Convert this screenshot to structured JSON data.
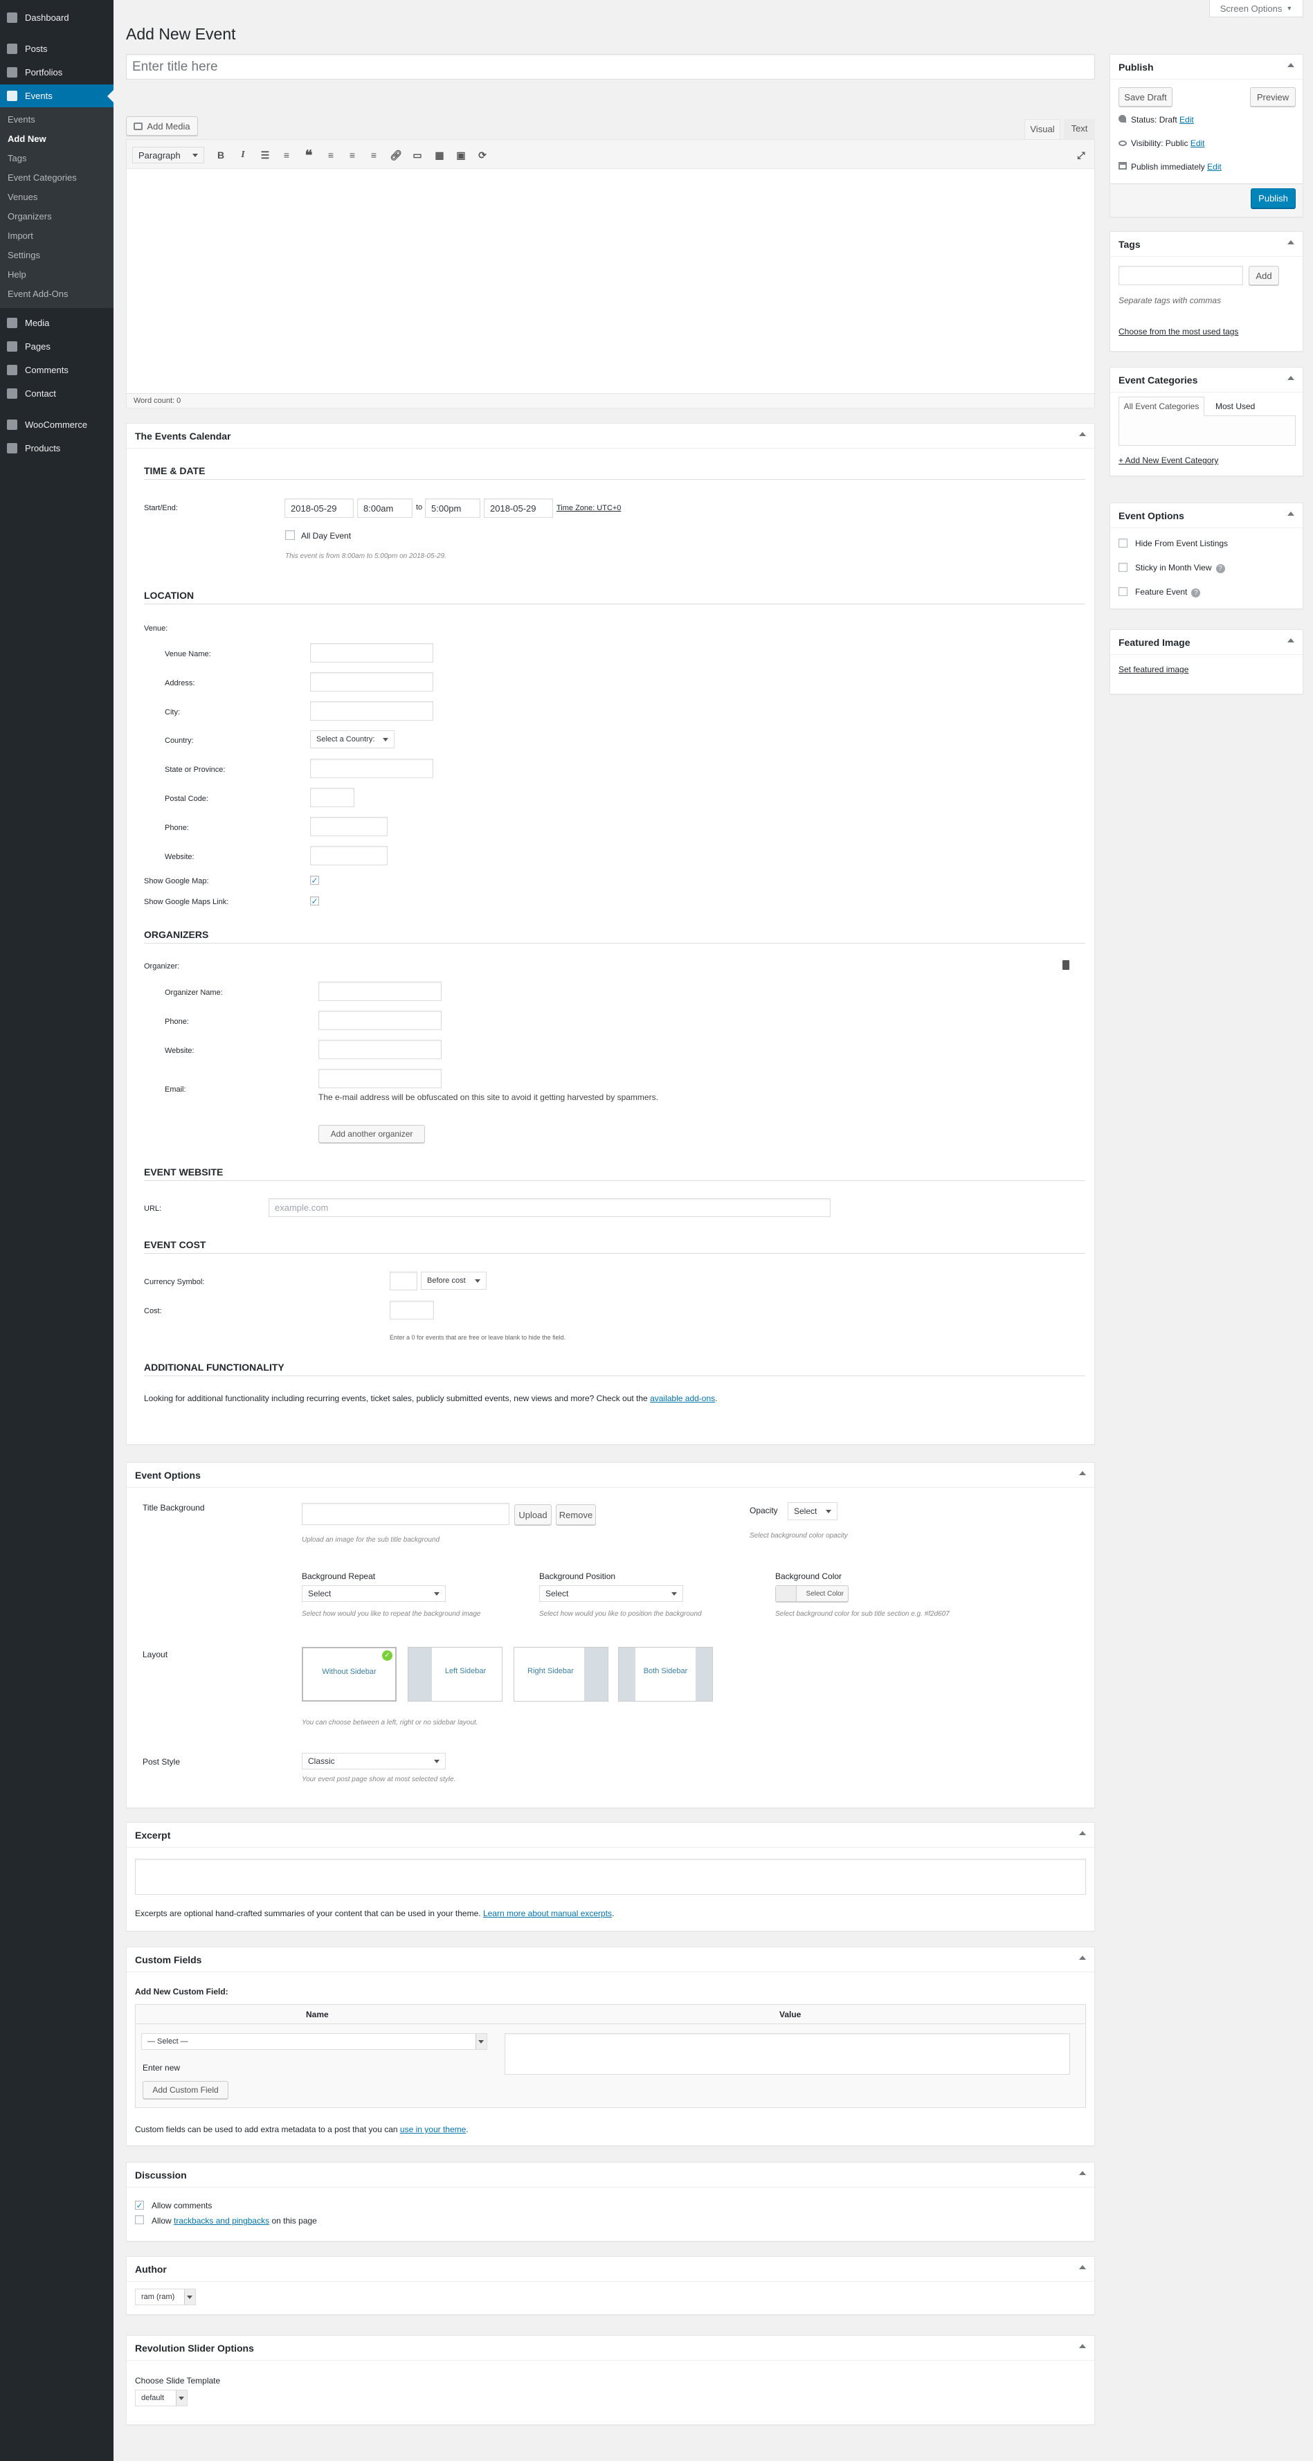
{
  "menu": {
    "items": [
      {
        "label": "Dashboard",
        "icon": "dashboard-icon",
        "name": "menu-dashboard"
      },
      {
        "label": "Posts",
        "icon": "pushpin-icon",
        "name": "menu-posts"
      },
      {
        "label": "Portfolios",
        "icon": "portfolio-icon",
        "name": "menu-portfolios"
      },
      {
        "label": "Events",
        "icon": "calendar-icon",
        "name": "menu-events"
      },
      {
        "label": "Media",
        "icon": "media-icon",
        "name": "menu-media"
      },
      {
        "label": "Pages",
        "icon": "page-icon",
        "name": "menu-pages"
      },
      {
        "label": "Comments",
        "icon": "comment-icon",
        "name": "menu-comments"
      },
      {
        "label": "Contact",
        "icon": "envelope-icon",
        "name": "menu-contact"
      },
      {
        "label": "WooCommerce",
        "icon": "woocommerce-icon",
        "name": "menu-woocommerce"
      },
      {
        "label": "Products",
        "icon": "products-icon",
        "name": "menu-products"
      }
    ],
    "submenu": [
      "Events",
      "Add New",
      "Tags",
      "Event Categories",
      "Venues",
      "Organizers",
      "Import",
      "Settings",
      "Help",
      "Event Add-Ons"
    ]
  },
  "screen_options": "Screen Options",
  "page_title": "Add New Event",
  "title_placeholder": "Enter title here",
  "editor": {
    "add_media": "Add Media",
    "tab_visual": "Visual",
    "tab_text": "Text",
    "format": "Paragraph",
    "word_count": "Word count: 0"
  },
  "publish": {
    "title": "Publish",
    "save_draft": "Save Draft",
    "preview": "Preview",
    "status_label": "Status: Draft",
    "visibility_label": "Visibility: Public",
    "schedule_label": "Publish immediately",
    "edit": "Edit",
    "publish_button": "Publish"
  },
  "tags_box": {
    "title": "Tags",
    "add": "Add",
    "hint": "Separate tags with commas",
    "choose": "Choose from the most used tags"
  },
  "categories_box": {
    "title": "Event Categories",
    "tab_all": "All Event Categories",
    "tab_most": "Most Used",
    "add_new": "+ Add New Event Category"
  },
  "event_options_side": {
    "title": "Event Options",
    "options": [
      "Hide From Event Listings",
      "Sticky in Month View",
      "Feature Event"
    ]
  },
  "featured_image": {
    "title": "Featured Image",
    "link": "Set featured image"
  },
  "tec": {
    "title": "The Events Calendar",
    "time_date": "TIME & DATE",
    "start_end": "Start/End:",
    "start_date": "2018-05-29",
    "start_time": "8:00am",
    "to": "to",
    "end_time": "5:00pm",
    "end_date": "2018-05-29",
    "timezone": "Time Zone: UTC+0",
    "all_day": "All Day Event",
    "summary": "This event is from 8:00am to 5:00pm on 2018-05-29.",
    "location": "LOCATION",
    "venue": "Venue:",
    "venue_fields": [
      "Venue Name:",
      "Address:",
      "City:",
      "Country:",
      "State or Province:",
      "Postal Code:",
      "Phone:",
      "Website:"
    ],
    "country_select": "Select a Country:",
    "show_map": "Show Google Map:",
    "show_map_link": "Show Google Maps Link:",
    "organizers": "ORGANIZERS",
    "organizer": "Organizer:",
    "org_fields": [
      "Organizer Name:",
      "Phone:",
      "Website:",
      "Email:"
    ],
    "email_note": "The e-mail address will be obfuscated on this site to avoid it getting harvested by spammers.",
    "add_organizer": "Add another organizer",
    "event_website": "EVENT WEBSITE",
    "url": "URL:",
    "url_placeholder": "example.com",
    "event_cost": "EVENT COST",
    "currency_symbol": "Currency Symbol:",
    "before_cost": "Before cost",
    "cost": "Cost:",
    "cost_note": "Enter a 0 for events that are free or leave blank to hide the field.",
    "additional": "ADDITIONAL FUNCTIONALITY",
    "additional_text": "Looking for additional functionality including recurring events, ticket sales, publicly submitted events, new views and more? Check out the",
    "addons_link": "available add-ons",
    "addons_end": "."
  },
  "event_options": {
    "title": "Event Options",
    "title_bg": "Title Background",
    "upload": "Upload",
    "remove": "Remove",
    "upload_hint": "Upload an image for the sub title background",
    "opacity": "Opacity",
    "opacity_select": "Select",
    "opacity_hint": "Select background color opacity",
    "bg_repeat": "Background Repeat",
    "bg_repeat_select": "Select",
    "bg_repeat_hint": "Select how would you like to repeat the background image",
    "bg_position": "Background Position",
    "bg_position_select": "Select",
    "bg_position_hint": "Select how would you like to position the background",
    "bg_color": "Background Color",
    "select_color": "Select Color",
    "bg_color_hint": "Select background color for sub title section e.g. #f2d607",
    "layout": "Layout",
    "layouts": [
      "Without Sidebar",
      "Left Sidebar",
      "Right Sidebar",
      "Both Sidebar"
    ],
    "layout_hint": "You can choose between a left, right or no sidebar layout.",
    "post_style": "Post Style",
    "post_style_value": "Classic",
    "post_style_hint": "Your event post page show at most selected style."
  },
  "excerpt": {
    "title": "Excerpt",
    "text": "Excerpts are optional hand-crafted summaries of your content that can be used in your theme.",
    "link": "Learn more about manual excerpts",
    "end": "."
  },
  "custom_fields": {
    "title": "Custom Fields",
    "add_new": "Add New Custom Field:",
    "col_name": "Name",
    "col_value": "Value",
    "select": "— Select —",
    "enter_new": "Enter new",
    "add_button": "Add Custom Field",
    "note": "Custom fields can be used to add extra metadata to a post that you can",
    "note_link": "use in your theme",
    "note_end": "."
  },
  "discussion": {
    "title": "Discussion",
    "allow_comments": "Allow comments",
    "allow": "Allow",
    "trackbacks": "trackbacks and pingbacks",
    "on_page": "on this page"
  },
  "author": {
    "title": "Author",
    "value": "ram (ram)"
  },
  "rev_slider": {
    "title": "Revolution Slider Options",
    "choose": "Choose Slide Template",
    "value": "default"
  }
}
